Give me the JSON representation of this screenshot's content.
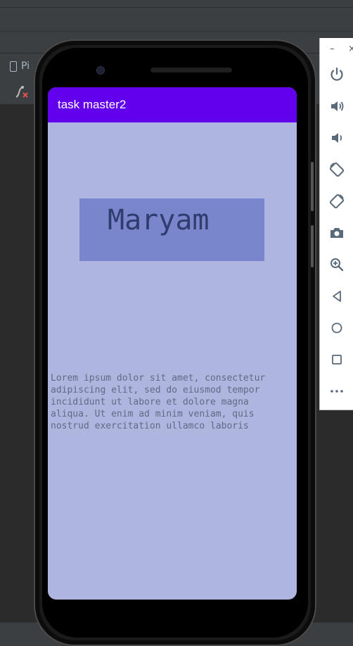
{
  "ide": {
    "device_tab_label": "Pi"
  },
  "app": {
    "title": "task master2",
    "name_text": "Maryam",
    "body_text": "Lorem ipsum dolor sit amet, consectetur\nadipiscing elit, sed do eiusmod tempor\nincididunt ut labore et dolore magna\naliqua. Ut enim ad minim veniam, quis\nnostrud exercitation ullamco laboris"
  },
  "emulator": {
    "minimize_label": "–",
    "close_label": "×",
    "controls": [
      "power-icon",
      "volume-up-icon",
      "volume-down-icon",
      "rotate-left-icon",
      "rotate-right-icon",
      "camera-icon",
      "zoom-icon",
      "back-icon",
      "home-icon",
      "overview-icon",
      "more-icon"
    ]
  },
  "colors": {
    "app_bar": "#6200ee",
    "screen_bg": "#aeb6e0",
    "name_box": "#7986cb",
    "emulator_icon": "#5a6a7a"
  }
}
